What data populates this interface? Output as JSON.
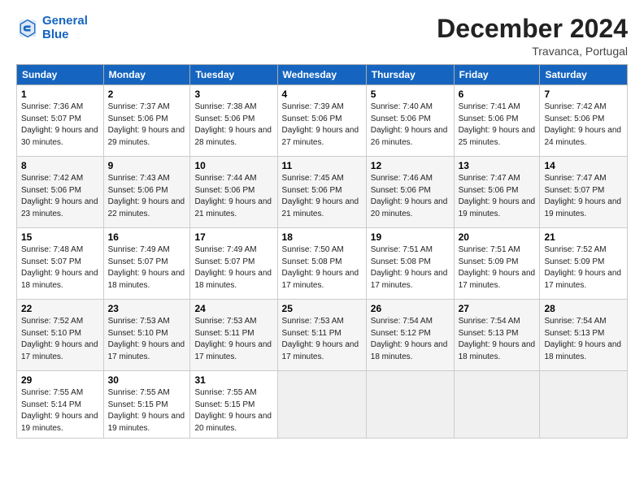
{
  "logo": {
    "line1": "General",
    "line2": "Blue"
  },
  "title": "December 2024",
  "location": "Travanca, Portugal",
  "days_of_week": [
    "Sunday",
    "Monday",
    "Tuesday",
    "Wednesday",
    "Thursday",
    "Friday",
    "Saturday"
  ],
  "weeks": [
    [
      {
        "day": "1",
        "sunrise": "Sunrise: 7:36 AM",
        "sunset": "Sunset: 5:07 PM",
        "daylight": "Daylight: 9 hours and 30 minutes."
      },
      {
        "day": "2",
        "sunrise": "Sunrise: 7:37 AM",
        "sunset": "Sunset: 5:06 PM",
        "daylight": "Daylight: 9 hours and 29 minutes."
      },
      {
        "day": "3",
        "sunrise": "Sunrise: 7:38 AM",
        "sunset": "Sunset: 5:06 PM",
        "daylight": "Daylight: 9 hours and 28 minutes."
      },
      {
        "day": "4",
        "sunrise": "Sunrise: 7:39 AM",
        "sunset": "Sunset: 5:06 PM",
        "daylight": "Daylight: 9 hours and 27 minutes."
      },
      {
        "day": "5",
        "sunrise": "Sunrise: 7:40 AM",
        "sunset": "Sunset: 5:06 PM",
        "daylight": "Daylight: 9 hours and 26 minutes."
      },
      {
        "day": "6",
        "sunrise": "Sunrise: 7:41 AM",
        "sunset": "Sunset: 5:06 PM",
        "daylight": "Daylight: 9 hours and 25 minutes."
      },
      {
        "day": "7",
        "sunrise": "Sunrise: 7:42 AM",
        "sunset": "Sunset: 5:06 PM",
        "daylight": "Daylight: 9 hours and 24 minutes."
      }
    ],
    [
      {
        "day": "8",
        "sunrise": "Sunrise: 7:42 AM",
        "sunset": "Sunset: 5:06 PM",
        "daylight": "Daylight: 9 hours and 23 minutes."
      },
      {
        "day": "9",
        "sunrise": "Sunrise: 7:43 AM",
        "sunset": "Sunset: 5:06 PM",
        "daylight": "Daylight: 9 hours and 22 minutes."
      },
      {
        "day": "10",
        "sunrise": "Sunrise: 7:44 AM",
        "sunset": "Sunset: 5:06 PM",
        "daylight": "Daylight: 9 hours and 21 minutes."
      },
      {
        "day": "11",
        "sunrise": "Sunrise: 7:45 AM",
        "sunset": "Sunset: 5:06 PM",
        "daylight": "Daylight: 9 hours and 21 minutes."
      },
      {
        "day": "12",
        "sunrise": "Sunrise: 7:46 AM",
        "sunset": "Sunset: 5:06 PM",
        "daylight": "Daylight: 9 hours and 20 minutes."
      },
      {
        "day": "13",
        "sunrise": "Sunrise: 7:47 AM",
        "sunset": "Sunset: 5:06 PM",
        "daylight": "Daylight: 9 hours and 19 minutes."
      },
      {
        "day": "14",
        "sunrise": "Sunrise: 7:47 AM",
        "sunset": "Sunset: 5:07 PM",
        "daylight": "Daylight: 9 hours and 19 minutes."
      }
    ],
    [
      {
        "day": "15",
        "sunrise": "Sunrise: 7:48 AM",
        "sunset": "Sunset: 5:07 PM",
        "daylight": "Daylight: 9 hours and 18 minutes."
      },
      {
        "day": "16",
        "sunrise": "Sunrise: 7:49 AM",
        "sunset": "Sunset: 5:07 PM",
        "daylight": "Daylight: 9 hours and 18 minutes."
      },
      {
        "day": "17",
        "sunrise": "Sunrise: 7:49 AM",
        "sunset": "Sunset: 5:07 PM",
        "daylight": "Daylight: 9 hours and 18 minutes."
      },
      {
        "day": "18",
        "sunrise": "Sunrise: 7:50 AM",
        "sunset": "Sunset: 5:08 PM",
        "daylight": "Daylight: 9 hours and 17 minutes."
      },
      {
        "day": "19",
        "sunrise": "Sunrise: 7:51 AM",
        "sunset": "Sunset: 5:08 PM",
        "daylight": "Daylight: 9 hours and 17 minutes."
      },
      {
        "day": "20",
        "sunrise": "Sunrise: 7:51 AM",
        "sunset": "Sunset: 5:09 PM",
        "daylight": "Daylight: 9 hours and 17 minutes."
      },
      {
        "day": "21",
        "sunrise": "Sunrise: 7:52 AM",
        "sunset": "Sunset: 5:09 PM",
        "daylight": "Daylight: 9 hours and 17 minutes."
      }
    ],
    [
      {
        "day": "22",
        "sunrise": "Sunrise: 7:52 AM",
        "sunset": "Sunset: 5:10 PM",
        "daylight": "Daylight: 9 hours and 17 minutes."
      },
      {
        "day": "23",
        "sunrise": "Sunrise: 7:53 AM",
        "sunset": "Sunset: 5:10 PM",
        "daylight": "Daylight: 9 hours and 17 minutes."
      },
      {
        "day": "24",
        "sunrise": "Sunrise: 7:53 AM",
        "sunset": "Sunset: 5:11 PM",
        "daylight": "Daylight: 9 hours and 17 minutes."
      },
      {
        "day": "25",
        "sunrise": "Sunrise: 7:53 AM",
        "sunset": "Sunset: 5:11 PM",
        "daylight": "Daylight: 9 hours and 17 minutes."
      },
      {
        "day": "26",
        "sunrise": "Sunrise: 7:54 AM",
        "sunset": "Sunset: 5:12 PM",
        "daylight": "Daylight: 9 hours and 18 minutes."
      },
      {
        "day": "27",
        "sunrise": "Sunrise: 7:54 AM",
        "sunset": "Sunset: 5:13 PM",
        "daylight": "Daylight: 9 hours and 18 minutes."
      },
      {
        "day": "28",
        "sunrise": "Sunrise: 7:54 AM",
        "sunset": "Sunset: 5:13 PM",
        "daylight": "Daylight: 9 hours and 18 minutes."
      }
    ],
    [
      {
        "day": "29",
        "sunrise": "Sunrise: 7:55 AM",
        "sunset": "Sunset: 5:14 PM",
        "daylight": "Daylight: 9 hours and 19 minutes."
      },
      {
        "day": "30",
        "sunrise": "Sunrise: 7:55 AM",
        "sunset": "Sunset: 5:15 PM",
        "daylight": "Daylight: 9 hours and 19 minutes."
      },
      {
        "day": "31",
        "sunrise": "Sunrise: 7:55 AM",
        "sunset": "Sunset: 5:15 PM",
        "daylight": "Daylight: 9 hours and 20 minutes."
      },
      null,
      null,
      null,
      null
    ]
  ]
}
